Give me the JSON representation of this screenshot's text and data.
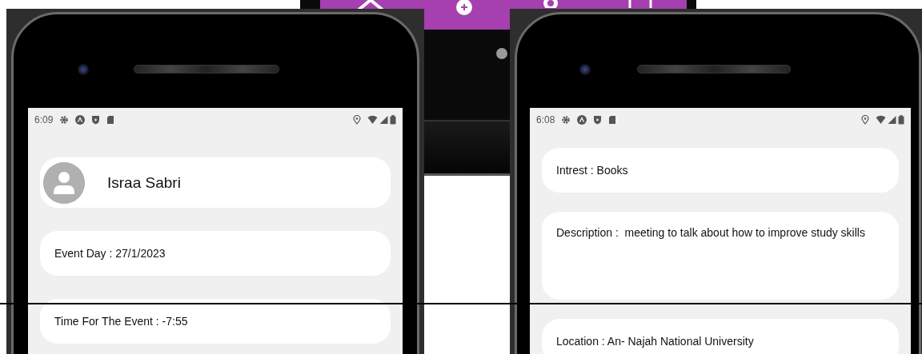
{
  "left_phone": {
    "status_bar": {
      "time": "6:09"
    },
    "profile": {
      "name": "Israa Sabri"
    },
    "cards": [
      {
        "kind": "line",
        "text": "Event Day : 27/1/2023"
      },
      {
        "kind": "line",
        "text": "Time For The Event : -7:55"
      }
    ]
  },
  "right_phone": {
    "status_bar": {
      "time": "6:08"
    },
    "cards": [
      {
        "kind": "line",
        "text": "Intrest : Books"
      },
      {
        "kind": "paragraph",
        "text": "Description :  meeting to talk about how to improve study skills"
      },
      {
        "kind": "line",
        "text": "Location : An- Najah National University"
      }
    ]
  }
}
